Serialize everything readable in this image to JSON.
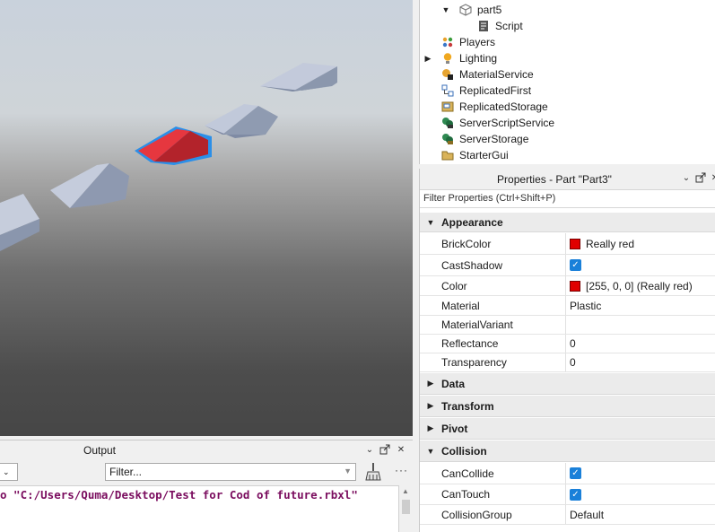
{
  "explorer": {
    "items": [
      {
        "label": "part5",
        "icon": "part-cube-icon",
        "expanded": true
      },
      {
        "label": "Script",
        "icon": "script-icon"
      },
      {
        "label": "Players",
        "icon": "players-icon"
      },
      {
        "label": "Lighting",
        "icon": "lighting-bulb-icon",
        "expanded": false
      },
      {
        "label": "MaterialService",
        "icon": "material-service-icon"
      },
      {
        "label": "ReplicatedFirst",
        "icon": "replicated-first-icon"
      },
      {
        "label": "ReplicatedStorage",
        "icon": "replicated-storage-icon"
      },
      {
        "label": "ServerScriptService",
        "icon": "server-script-service-icon"
      },
      {
        "label": "ServerStorage",
        "icon": "server-storage-icon"
      },
      {
        "label": "StarterGui",
        "icon": "starter-gui-icon"
      }
    ]
  },
  "properties": {
    "title": "Properties - Part \"Part3\"",
    "filter_placeholder": "Filter Properties (Ctrl+Shift+P)",
    "categories": {
      "appearance": "Appearance",
      "data": "Data",
      "transform": "Transform",
      "pivot": "Pivot",
      "collision": "Collision"
    },
    "appearance": {
      "brickcolor": {
        "name": "BrickColor",
        "value": "Really red"
      },
      "castshadow": {
        "name": "CastShadow",
        "checked": true
      },
      "color": {
        "name": "Color",
        "value": "[255, 0, 0] (Really red)"
      },
      "material": {
        "name": "Material",
        "value": "Plastic"
      },
      "materialvariant": {
        "name": "MaterialVariant",
        "value": ""
      },
      "reflectance": {
        "name": "Reflectance",
        "value": "0"
      },
      "transparency": {
        "name": "Transparency",
        "value": "0"
      }
    },
    "collision": {
      "cancollide": {
        "name": "CanCollide",
        "checked": true
      },
      "cantouch": {
        "name": "CanTouch",
        "checked": true
      },
      "collisiongroup": {
        "name": "CollisionGroup",
        "value": "Default"
      }
    },
    "swatch_color": "#e00000"
  },
  "output": {
    "title": "Output",
    "filter_placeholder": "Filter...",
    "log_line": "o \"C:/Users/Quma/Desktop/Test for Cod of future.rbxl\"",
    "log_color": "#7a0c5e"
  },
  "viewport": {
    "selected_part_color": "#e8323f",
    "selection_outline_color": "#2b8fe8",
    "part_color": "#b7bfd3"
  }
}
